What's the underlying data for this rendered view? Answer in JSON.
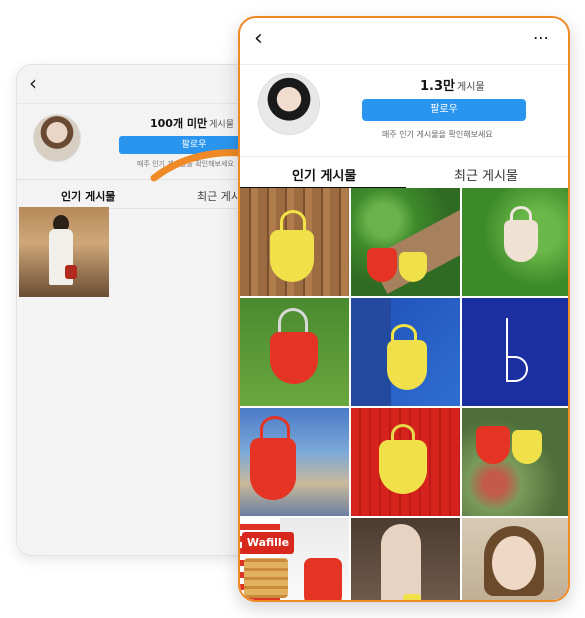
{
  "back_profile": {
    "count_value": "100개 미만",
    "count_unit": "게시물",
    "follow_label": "팔로우",
    "note": "매주 인기 게시물을 확인해보세요",
    "tab_popular": "인기 게시물",
    "tab_recent": "최근 게시물"
  },
  "front_profile": {
    "count_value": "1.3만",
    "count_unit": "게시물",
    "follow_label": "팔로우",
    "note": "매주 인기 게시물을 확인해보세요",
    "tab_popular": "인기 게시물",
    "tab_recent": "최근 게시물",
    "more_icon": "⋯"
  },
  "grid": {
    "items": [
      "yellow-bag",
      "red-yellow-bags",
      "white-bag",
      "red-bag-grass",
      "yellow-bag-blue",
      "logo-b",
      "red-bag-mural",
      "yellow-bag-red",
      "red-yellow-flowers",
      "wafille-red-bag",
      "mirror-selfie",
      "woman-portrait"
    ],
    "wafille_text": "Wafille"
  },
  "colors": {
    "follow_blue": "#2a95ef",
    "accent_orange": "#f08a26",
    "bag_yellow": "#f0e14a",
    "bag_red": "#e53324"
  }
}
